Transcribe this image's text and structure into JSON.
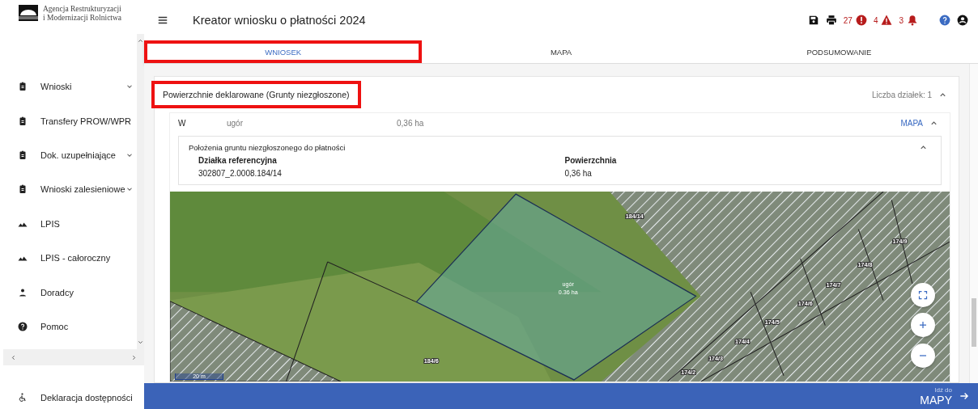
{
  "logo": {
    "lines": [
      "Agencja Restrukturyzacji",
      "i Modernizacji Rolnictwa"
    ]
  },
  "sidebar": {
    "items": [
      {
        "label": "Wnioski",
        "kind": "clipboard",
        "expandable": true
      },
      {
        "label": "Transfery PROW/WPR",
        "kind": "clipboard",
        "expandable": false
      },
      {
        "label": "Dok. uzupełniające",
        "kind": "clipboard",
        "expandable": true
      },
      {
        "label": "Wnioski zalesieniowe",
        "kind": "clipboard",
        "expandable": true
      },
      {
        "label": "LPIS",
        "kind": "mountain",
        "expandable": false
      },
      {
        "label": "LPIS - całoroczny",
        "kind": "mountain",
        "expandable": false
      },
      {
        "label": "Doradcy",
        "kind": "person",
        "expandable": false
      },
      {
        "label": "Pomoc",
        "kind": "help",
        "expandable": false
      }
    ],
    "footer": "Deklaracja dostępności"
  },
  "header": {
    "title": "Kreator wniosku o płatności 2024",
    "counters": [
      {
        "count": "27",
        "kind": "error"
      },
      {
        "count": "4",
        "kind": "warning"
      },
      {
        "count": "3",
        "kind": "bell"
      }
    ]
  },
  "tabs": [
    {
      "label": "WNIOSEK",
      "selected": true,
      "highlighted": true
    },
    {
      "label": "MAPA",
      "selected": false,
      "highlighted": false
    },
    {
      "label": "PODSUMOWANIE",
      "selected": false,
      "highlighted": false
    }
  ],
  "section": {
    "title": "Powierzchnie deklarowane (Grunty niezgłoszone)",
    "highlighted": true,
    "count": "Liczba działek: 1",
    "expanded": true,
    "row": {
      "code": "W",
      "name": "ugór",
      "area": "0,36 ha",
      "link": "MAPA",
      "expanded": true,
      "panel": {
        "title": "Położenia gruntu niezgłoszonego do płatności",
        "expanded": true,
        "fields": [
          {
            "label": "Działka referencyjna",
            "value": "302807_2.0008.184/14"
          },
          {
            "label": "Powierzchnia",
            "value": "0,36 ha"
          }
        ]
      }
    },
    "map": {
      "parcel_name": "ugór",
      "parcel_area": "0.36 ha",
      "scale": "20 m",
      "labels": [
        "184/14",
        "184/6",
        "174/9",
        "174/8",
        "174/7",
        "174/6",
        "174/5",
        "174/4",
        "174/3",
        "174/2"
      ]
    }
  },
  "footer_bar": {
    "small": "Idź do",
    "big": "MAPY"
  }
}
